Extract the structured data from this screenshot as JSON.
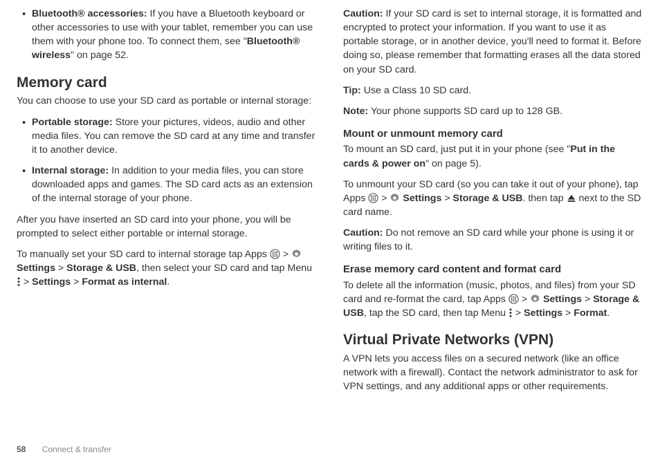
{
  "left": {
    "bullets_top": [
      {
        "label": "Bluetooth® accessories:",
        "text": " If you have a Bluetooth keyboard or other accessories to use with your tablet, remember you can use them with your phone too. To connect them, see \"",
        "bold_ref": "Bluetooth® wireless",
        "suffix": "\" on page 52."
      }
    ],
    "h2_memory": "Memory card",
    "p_memory_intro": "You can choose to use your SD card as portable or internal storage:",
    "bullets_storage": [
      {
        "label": "Portable storage:",
        "text": " Store your pictures, videos, audio and other media files. You can remove the SD card at any time and transfer it to another device."
      },
      {
        "label": "Internal storage:",
        "text": " In addition to your media files, you can store downloaded apps and games. The SD card acts as an extension of the internal storage of your phone."
      }
    ],
    "p_after_insert": "After you have inserted an SD card into your phone, you will be prompted to select either portable or internal storage.",
    "p_manual_pre": "To manually set your SD card to internal storage tap Apps ",
    "gt": " > ",
    "b_settings": " Settings",
    "b_storage": "Storage & USB",
    "p_manual_mid": ", then select your SD card and tap Menu ",
    "b_settings2": "Settings",
    "b_format_internal": "Format as internal",
    "period": "."
  },
  "right": {
    "p_caution1_label": "Caution:",
    "p_caution1": " If your SD card is set to internal storage, it is formatted and encrypted to protect your information. If you want to use it as portable storage, or in another device, you'll need to format it. Before doing so, please remember that formatting erases all the data stored on your SD card.",
    "p_tip_label": "Tip:",
    "p_tip": " Use a Class 10 SD card.",
    "p_note_label": "Note:",
    "p_note": " Your phone supports SD card up to 128 GB.",
    "h3_mount": "Mount or unmount memory card",
    "p_mount_pre": "To mount an SD card, just put it in your phone (see \"",
    "b_putin": "Put in the cards & power on",
    "p_mount_suf": "\" on page 5).",
    "p_unmount_pre": "To unmount your SD card (so you can take it out of your phone), tap Apps ",
    "gt": " > ",
    "b_settings": " Settings",
    "b_storage": "Storage & USB",
    "p_unmount_mid": ". then tap ",
    "p_unmount_suf": " next to the SD card name.",
    "p_caution2_label": "Caution:",
    "p_caution2": " Do not remove an SD card while your phone is using it or writing files to it.",
    "h3_erase": "Erase memory card content and format card",
    "p_erase_pre": "To delete all the information (music, photos, and files) from your SD card and re-format the card, tap Apps ",
    "p_erase_mid": ", tap the SD card, then tap Menu ",
    "b_settings2": "Settings",
    "b_format": "Format",
    "period": ".",
    "h2_vpn": "Virtual Private Networks (VPN)",
    "p_vpn": "A VPN lets you access files on a secured network (like an office network with a firewall). Contact the network administrator to ask for VPN settings, and any additional apps or other requirements."
  },
  "footer": {
    "page": "58",
    "section": "Connect & transfer"
  }
}
